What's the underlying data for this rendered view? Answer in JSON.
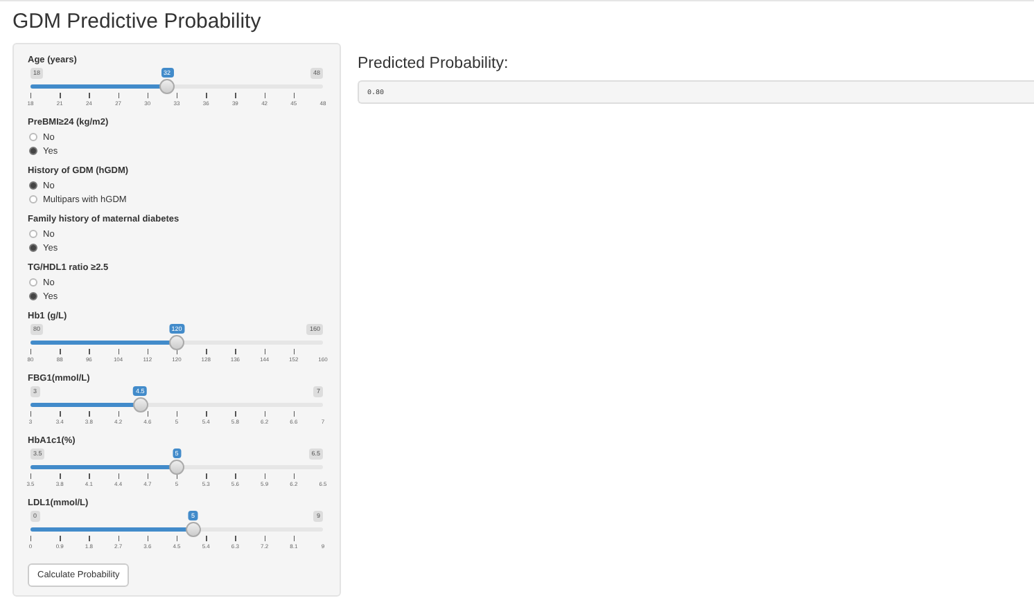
{
  "title": "GDM Predictive Probability",
  "inputs": [
    {
      "kind": "slider",
      "label": "Age (years)",
      "min": "18",
      "max": "48",
      "value": "32",
      "level": 0.467,
      "ticks": [
        "18",
        "21",
        "24",
        "27",
        "30",
        "33",
        "36",
        "39",
        "42",
        "45",
        "48"
      ]
    },
    {
      "kind": "radio",
      "label": "PreBMI≥24  (kg/m2)",
      "options": [
        {
          "label": "No",
          "selected": false
        },
        {
          "label": "Yes",
          "selected": true
        }
      ]
    },
    {
      "kind": "radio",
      "label": "History of GDM (hGDM)",
      "options": [
        {
          "label": "No",
          "selected": true
        },
        {
          "label": "Multipars with hGDM",
          "selected": false
        }
      ]
    },
    {
      "kind": "radio",
      "label": "Family history of maternal diabetes",
      "options": [
        {
          "label": "No",
          "selected": false
        },
        {
          "label": "Yes",
          "selected": true
        }
      ]
    },
    {
      "kind": "radio",
      "label": "TG/HDL1 ratio ≥2.5",
      "options": [
        {
          "label": "No",
          "selected": false
        },
        {
          "label": "Yes",
          "selected": true
        }
      ]
    },
    {
      "kind": "slider",
      "label": "Hb1 (g/L)",
      "min": "80",
      "max": "160",
      "value": "120",
      "level": 0.5,
      "ticks": [
        "80",
        "88",
        "96",
        "104",
        "112",
        "120",
        "128",
        "136",
        "144",
        "152",
        "160"
      ]
    },
    {
      "kind": "slider",
      "label": "FBG1(mmol/L)",
      "min": "3",
      "max": "7",
      "value": "4.5",
      "level": 0.375,
      "ticks": [
        "3",
        "3.4",
        "3.8",
        "4.2",
        "4.6",
        "5",
        "5.4",
        "5.8",
        "6.2",
        "6.6",
        "7"
      ]
    },
    {
      "kind": "slider",
      "label": "HbA1c1(%)",
      "min": "3.5",
      "max": "6.5",
      "value": "5",
      "level": 0.5,
      "ticks": [
        "3.5",
        "3.8",
        "4.1",
        "4.4",
        "4.7",
        "5",
        "5.3",
        "5.6",
        "5.9",
        "6.2",
        "6.5"
      ]
    },
    {
      "kind": "slider",
      "label": "LDL1(mmol/L)",
      "min": "0",
      "max": "9",
      "value": "5",
      "level": 0.556,
      "ticks": [
        "0",
        "0.9",
        "1.8",
        "2.7",
        "3.6",
        "4.5",
        "5.4",
        "6.3",
        "7.2",
        "8.1",
        "9"
      ]
    }
  ],
  "button": "Calculate Probability",
  "output": {
    "heading": "Predicted Probability:",
    "value": "0.80"
  }
}
